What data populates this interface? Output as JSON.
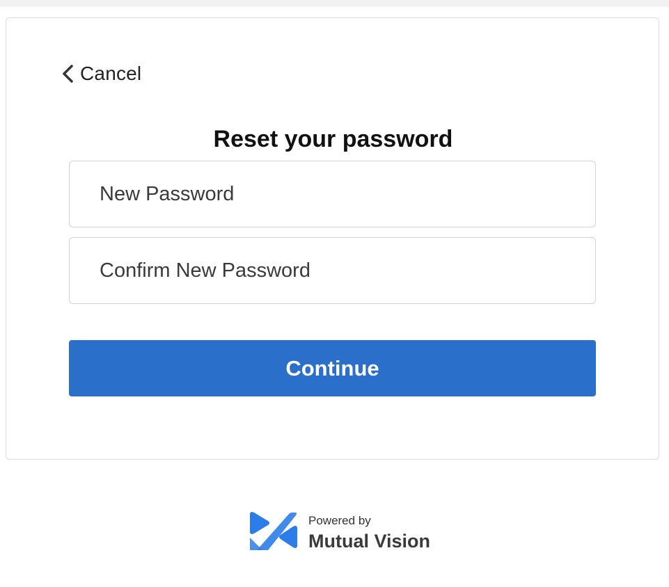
{
  "form": {
    "cancel_label": "Cancel",
    "title": "Reset your password",
    "new_password_placeholder": "New Password",
    "confirm_password_placeholder": "Confirm New Password",
    "continue_label": "Continue"
  },
  "footer": {
    "powered_by": "Powered by",
    "brand": "Mutual Vision"
  },
  "icons": {
    "back": "chevron-left-icon",
    "logo": "mutual-vision-logo-icon"
  },
  "colors": {
    "primary_button": "#2a6fc9",
    "logo_blue": "#2b7de9",
    "page_background": "#ffffff",
    "top_strip": "#f2f2f2"
  }
}
